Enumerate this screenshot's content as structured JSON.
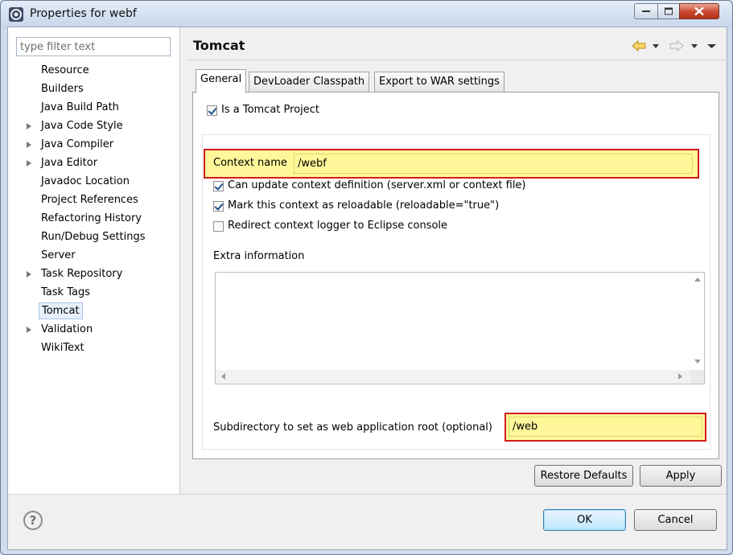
{
  "window": {
    "title": "Properties for webf"
  },
  "filter": {
    "placeholder": "type filter text",
    "value": ""
  },
  "tree": {
    "items": [
      {
        "label": "Resource",
        "expandable": false,
        "selected": false
      },
      {
        "label": "Builders",
        "expandable": false,
        "selected": false
      },
      {
        "label": "Java Build Path",
        "expandable": false,
        "selected": false
      },
      {
        "label": "Java Code Style",
        "expandable": true,
        "selected": false
      },
      {
        "label": "Java Compiler",
        "expandable": true,
        "selected": false
      },
      {
        "label": "Java Editor",
        "expandable": true,
        "selected": false
      },
      {
        "label": "Javadoc Location",
        "expandable": false,
        "selected": false
      },
      {
        "label": "Project References",
        "expandable": false,
        "selected": false
      },
      {
        "label": "Refactoring History",
        "expandable": false,
        "selected": false
      },
      {
        "label": "Run/Debug Settings",
        "expandable": false,
        "selected": false
      },
      {
        "label": "Server",
        "expandable": false,
        "selected": false
      },
      {
        "label": "Task Repository",
        "expandable": true,
        "selected": false
      },
      {
        "label": "Task Tags",
        "expandable": false,
        "selected": false
      },
      {
        "label": "Tomcat",
        "expandable": false,
        "selected": true
      },
      {
        "label": "Validation",
        "expandable": true,
        "selected": false
      },
      {
        "label": "WikiText",
        "expandable": false,
        "selected": false
      }
    ]
  },
  "page": {
    "title": "Tomcat"
  },
  "tabs": [
    {
      "label": "General",
      "active": true
    },
    {
      "label": "DevLoader Classpath",
      "active": false
    },
    {
      "label": "Export to WAR settings",
      "active": false
    }
  ],
  "general": {
    "is_tomcat_project": {
      "label": "Is a Tomcat Project",
      "checked": true
    },
    "context_name": {
      "label": "Context name",
      "value": "/webf"
    },
    "can_update": {
      "label": "Can update context definition (server.xml or context file)",
      "checked": true
    },
    "reloadable": {
      "label": "Mark this context as reloadable (reloadable=\"true\")",
      "checked": true
    },
    "redirect_logger": {
      "label": "Redirect context logger to Eclipse console",
      "checked": false
    },
    "extra_info": {
      "label": "Extra information",
      "value": ""
    },
    "subdirectory": {
      "label": "Subdirectory to set as web application root (optional)",
      "value": "/web"
    }
  },
  "buttons": {
    "restore_defaults": "Restore Defaults",
    "apply": "Apply",
    "ok": "OK",
    "cancel": "Cancel"
  },
  "colors": {
    "highlight_fill": "#fff79a",
    "highlight_border": "#d11d1d",
    "close_button": "#c8452d"
  }
}
